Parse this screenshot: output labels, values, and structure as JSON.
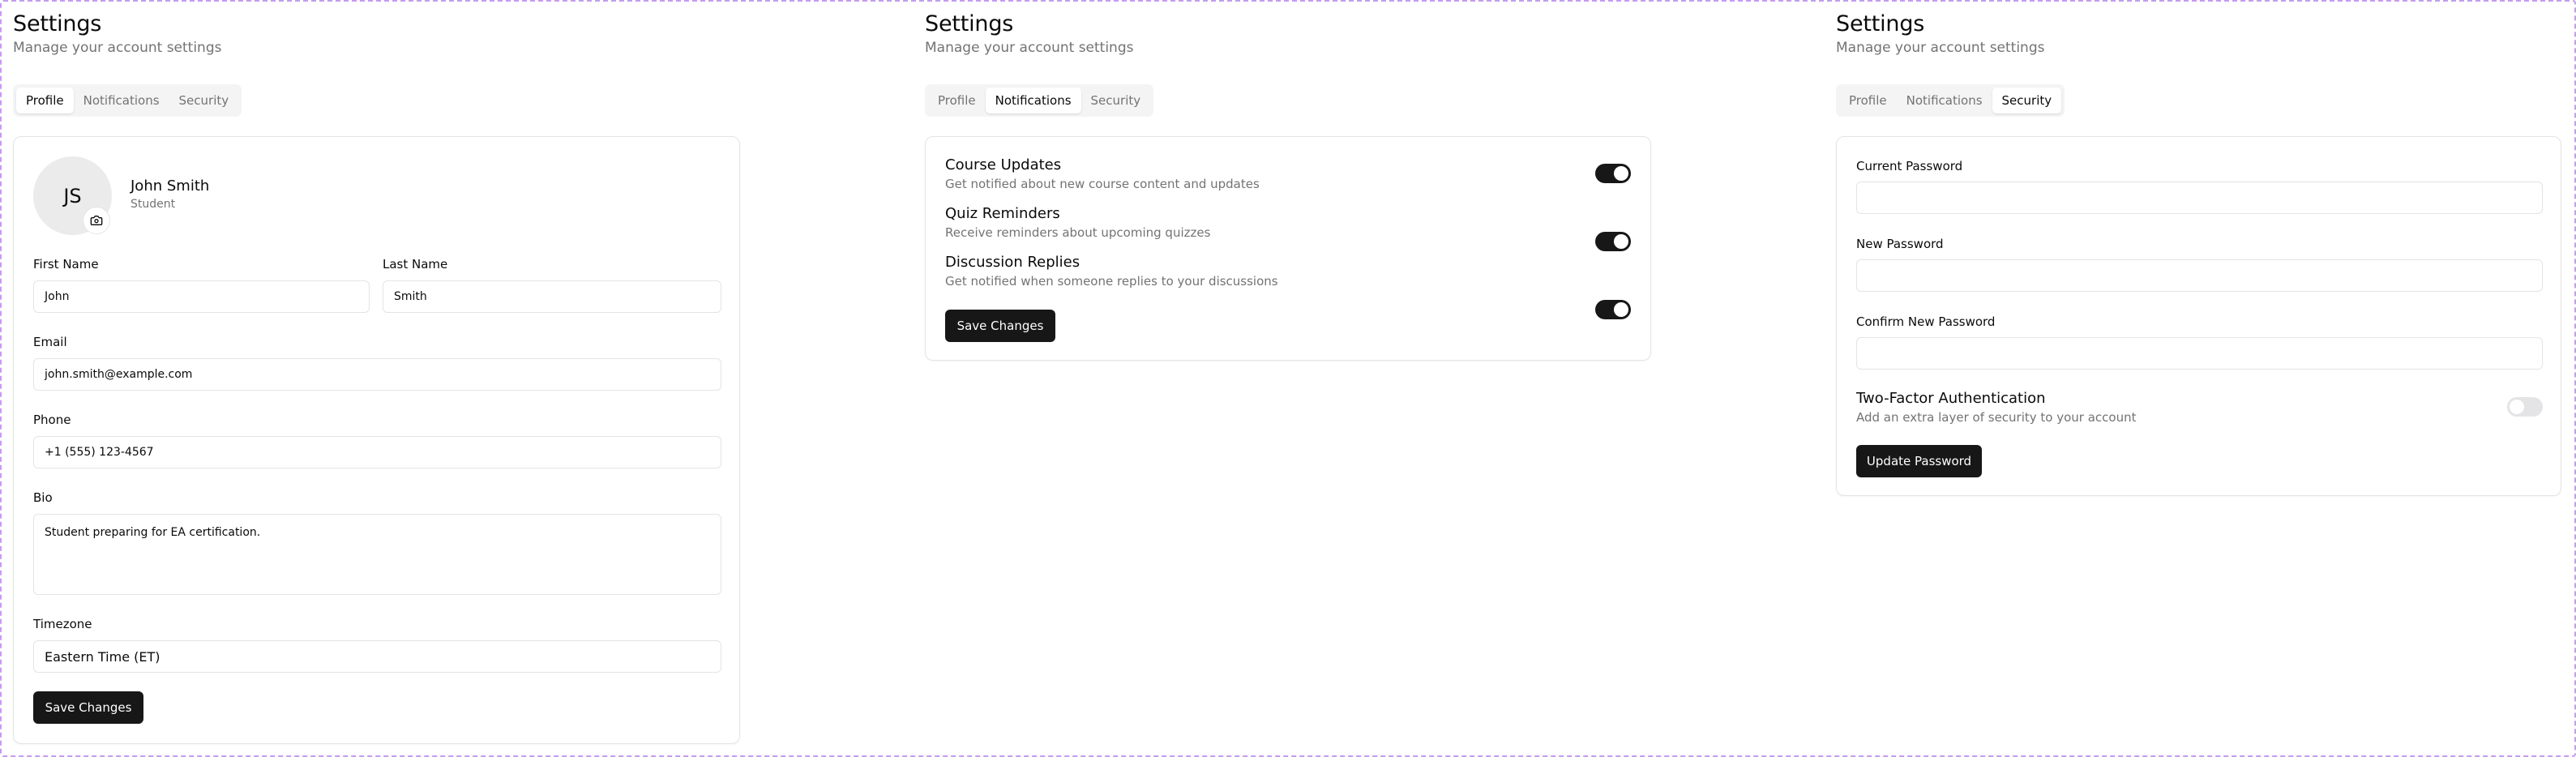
{
  "settings": {
    "title": "Settings",
    "subtitle": "Manage your account settings",
    "tabs": [
      "Profile",
      "Notifications",
      "Security"
    ]
  },
  "profile": {
    "initials": "JS",
    "name": "John Smith",
    "role": "Student",
    "first_name_label": "First Name",
    "first_name_value": "John",
    "last_name_label": "Last Name",
    "last_name_value": "Smith",
    "email_label": "Email",
    "email_value": "john.smith@example.com",
    "phone_label": "Phone",
    "phone_value": "+1 (555) 123-4567",
    "bio_label": "Bio",
    "bio_value": "Student preparing for EA certification.",
    "timezone_label": "Timezone",
    "timezone_value": "Eastern Time (ET)",
    "save_label": "Save Changes"
  },
  "notifications": {
    "items": [
      {
        "title": "Course Updates",
        "desc": "Get notified about new course content and updates",
        "enabled": true
      },
      {
        "title": "Quiz Reminders",
        "desc": "Receive reminders about upcoming quizzes",
        "enabled": true
      },
      {
        "title": "Discussion Replies",
        "desc": "Get notified when someone replies to your discussions",
        "enabled": true
      }
    ],
    "save_label": "Save Changes"
  },
  "security": {
    "current_password_label": "Current Password",
    "new_password_label": "New Password",
    "confirm_password_label": "Confirm New Password",
    "two_factor_title": "Two-Factor Authentication",
    "two_factor_desc": "Add an extra layer of security to your account",
    "two_factor_enabled": false,
    "update_label": "Update Password"
  },
  "icons": {
    "avatar_upload": "camera-icon"
  },
  "colors": {
    "primary_button": "#171717",
    "muted_text": "#737373",
    "border": "#e4e4e7",
    "frame_dashed": "#c49cf0"
  }
}
